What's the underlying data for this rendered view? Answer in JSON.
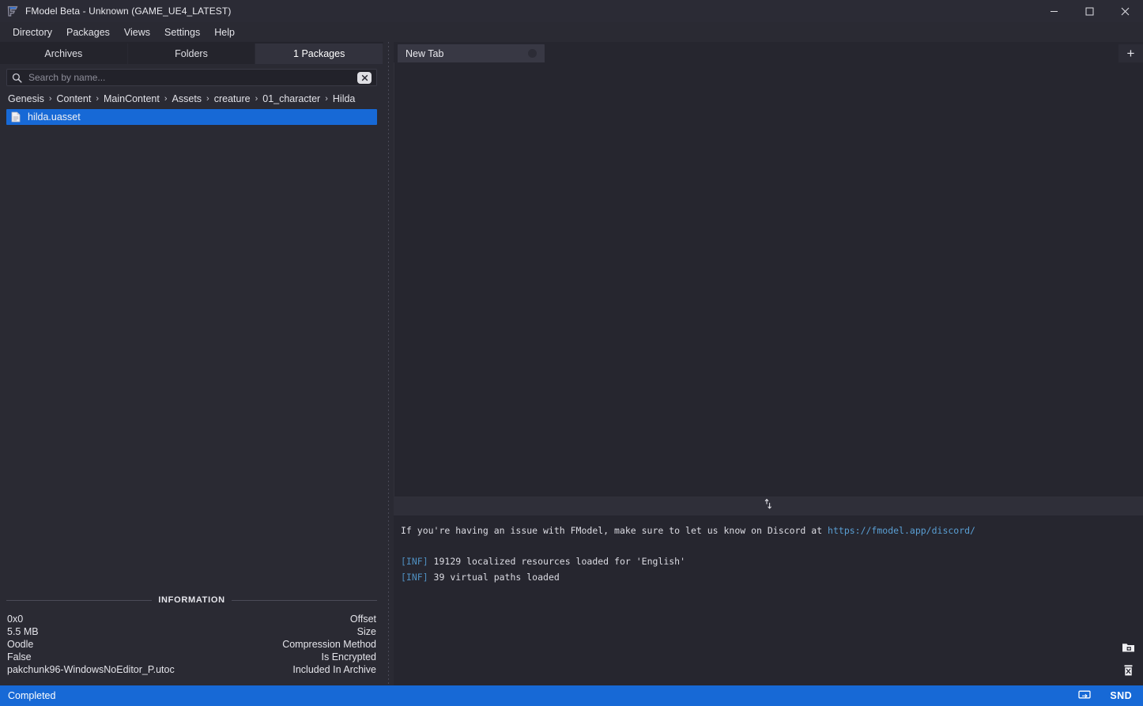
{
  "window": {
    "title": "FModel Beta - Unknown (GAME_UE4_LATEST)",
    "logo_icon": "fmodel-logo-icon",
    "minimize_icon": "minimize-icon",
    "maximize_icon": "maximize-icon",
    "close_icon": "close-icon"
  },
  "menu": {
    "items": [
      {
        "label": "Directory"
      },
      {
        "label": "Packages"
      },
      {
        "label": "Views"
      },
      {
        "label": "Settings"
      },
      {
        "label": "Help"
      }
    ]
  },
  "left_panel": {
    "tabs": [
      {
        "label": "Archives",
        "active": false
      },
      {
        "label": "Folders",
        "active": false
      },
      {
        "label": "1 Packages",
        "active": true
      }
    ],
    "search": {
      "placeholder": "Search by name...",
      "value": "",
      "icon": "search-icon",
      "clear_icon": "clear-x-icon"
    },
    "breadcrumb": [
      "Genesis",
      "Content",
      "MainContent",
      "Assets",
      "creature",
      "01_character",
      "Hilda"
    ],
    "breadcrumb_separator": "›",
    "files": [
      {
        "name": "hilda.uasset",
        "icon": "file-document-icon",
        "selected": true
      }
    ],
    "information": {
      "title": "INFORMATION",
      "rows": [
        {
          "value": "0x0",
          "key": "Offset"
        },
        {
          "value": "5.5 MB",
          "key": "Size"
        },
        {
          "value": "Oodle",
          "key": "Compression Method"
        },
        {
          "value": "False",
          "key": "Is Encrypted"
        },
        {
          "value": "pakchunk96-WindowsNoEditor_P.utoc",
          "key": "Included In Archive"
        }
      ]
    }
  },
  "right_panel": {
    "tabs": [
      {
        "label": "New Tab",
        "active": true,
        "close_icon": "tab-close-icon"
      }
    ],
    "new_tab_button": "+",
    "splitter_icon": "vertical-resize-icon",
    "log": {
      "lines": [
        {
          "type": "text_with_link",
          "text": "If you're having an issue with FModel, make sure to let us know on Discord at ",
          "link": "https://fmodel.app/discord/"
        },
        {
          "type": "blank"
        },
        {
          "type": "info",
          "tag": "[INF]",
          "text": " 19129 localized resources loaded for 'English'"
        },
        {
          "type": "info",
          "tag": "[INF]",
          "text": " 39 virtual paths loaded"
        }
      ],
      "actions": [
        {
          "icon": "open-folder-icon"
        },
        {
          "icon": "trash-delete-icon"
        }
      ]
    }
  },
  "statusbar": {
    "text": "Completed",
    "snd_icon": "sound-device-icon",
    "snd_label": "SND",
    "accent_color": "#1769d6"
  }
}
